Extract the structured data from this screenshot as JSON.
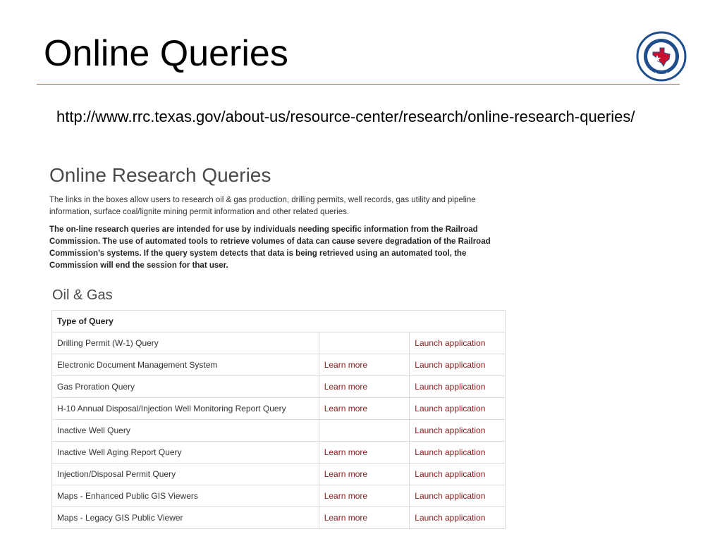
{
  "slide": {
    "title": "Online Queries",
    "url": "http://www.rrc.texas.gov/about-us/resource-center/research/online-research-queries/",
    "logo_text": "RAILROAD COMMISSION OF TEXAS"
  },
  "page": {
    "heading": "Online Research Queries",
    "intro": "The links in the boxes allow users to research oil & gas production, drilling permits, well records, gas utility and pipeline information, surface coal/lignite mining permit information and other related queries.",
    "notice": "The on-line research queries are intended for use by individuals needing specific information from the Railroad Commission. The use of automated tools to retrieve volumes of data can cause severe degradation of the Railroad Commission’s systems. If the query system detects that data is being retrieved using an automated tool, the Commission will end the session for that user.",
    "section_title": "Oil & Gas",
    "table_header": "Type of Query",
    "rows": [
      {
        "name": "Drilling Permit (W-1) Query",
        "learn": "",
        "launch": "Launch application"
      },
      {
        "name": "Electronic Document Management System",
        "learn": "Learn more",
        "launch": "Launch application"
      },
      {
        "name": "Gas Proration Query",
        "learn": "Learn more",
        "launch": "Launch application"
      },
      {
        "name": "H-10 Annual Disposal/Injection Well Monitoring Report Query",
        "learn": "Learn more",
        "launch": "Launch application"
      },
      {
        "name": "Inactive Well Query",
        "learn": "",
        "launch": "Launch application"
      },
      {
        "name": "Inactive Well Aging Report Query",
        "learn": "Learn more",
        "launch": "Launch application"
      },
      {
        "name": "Injection/Disposal Permit Query",
        "learn": "Learn more",
        "launch": "Launch application"
      },
      {
        "name": "Maps - Enhanced Public GIS Viewers",
        "learn": "Learn more",
        "launch": "Launch application"
      },
      {
        "name": "Maps - Legacy GIS Public Viewer",
        "learn": "Learn more",
        "launch": "Launch application"
      }
    ]
  },
  "colors": {
    "rule": "#c0504d",
    "link": "#8b1a1a",
    "seal_blue": "#1f4e8c",
    "seal_red": "#c8102e"
  }
}
